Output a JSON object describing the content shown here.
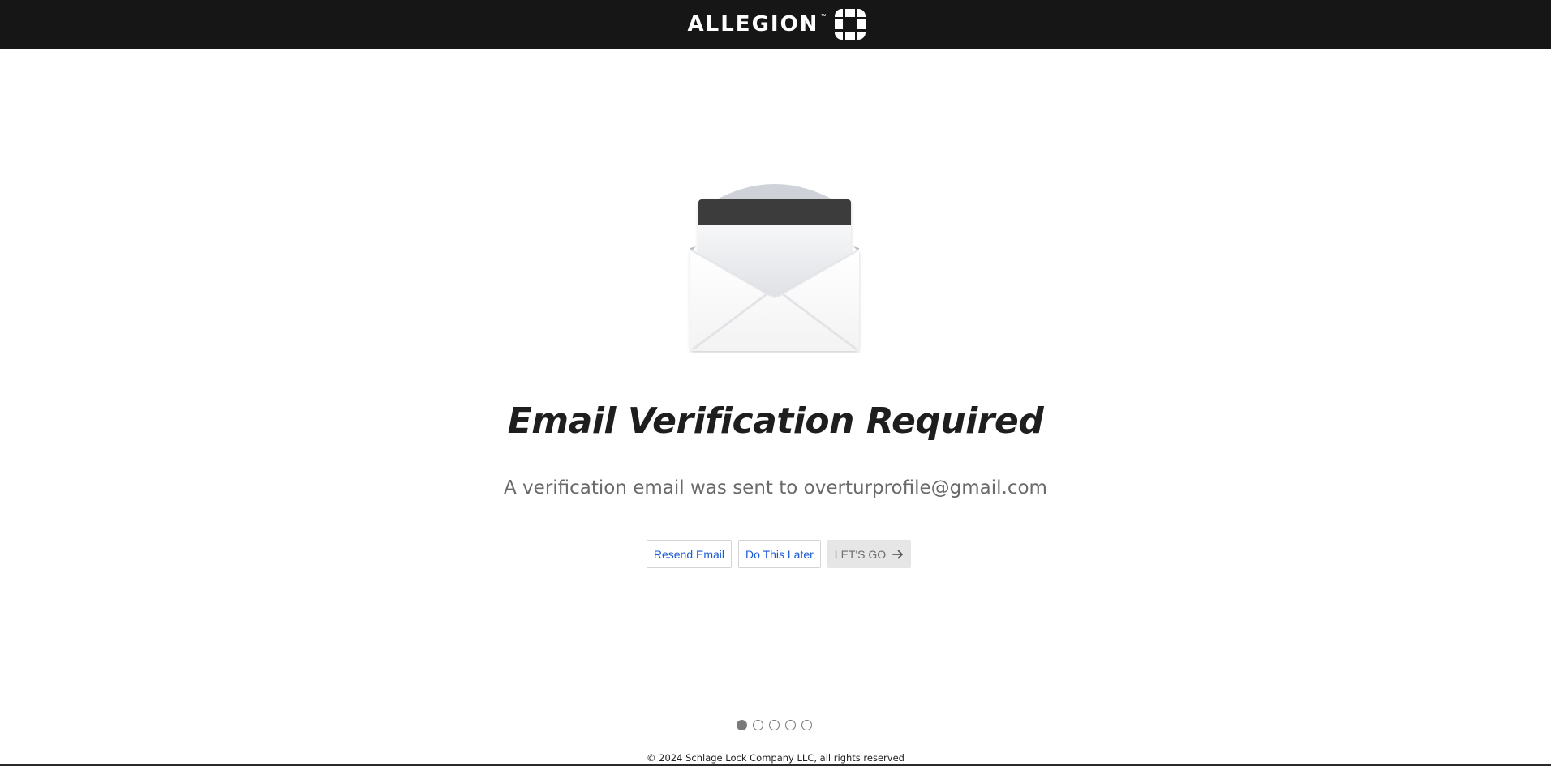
{
  "header": {
    "brand": "ALLEGION",
    "tm": "™"
  },
  "main": {
    "title": "Email Verification Required",
    "subtitle_prefix": "A verification email was sent to ",
    "email": "overturprofile@gmail.com",
    "buttons": {
      "resend": "Resend Email",
      "later": "Do This Later",
      "lets_go": "LET'S GO"
    }
  },
  "pagination": {
    "total": 5,
    "active": 1
  },
  "footer": {
    "copyright": "© 2024 Schlage Lock Company LLC, all rights reserved"
  },
  "colors": {
    "topbar": "#161616",
    "link_blue": "#1a5ad7",
    "title": "#1e1e1e",
    "subtitle": "#6a6a6a"
  },
  "icons": {
    "brand_mark": "allegion-logo-icon",
    "envelope": "open-envelope-icon",
    "arrow": "arrow-right-icon"
  }
}
